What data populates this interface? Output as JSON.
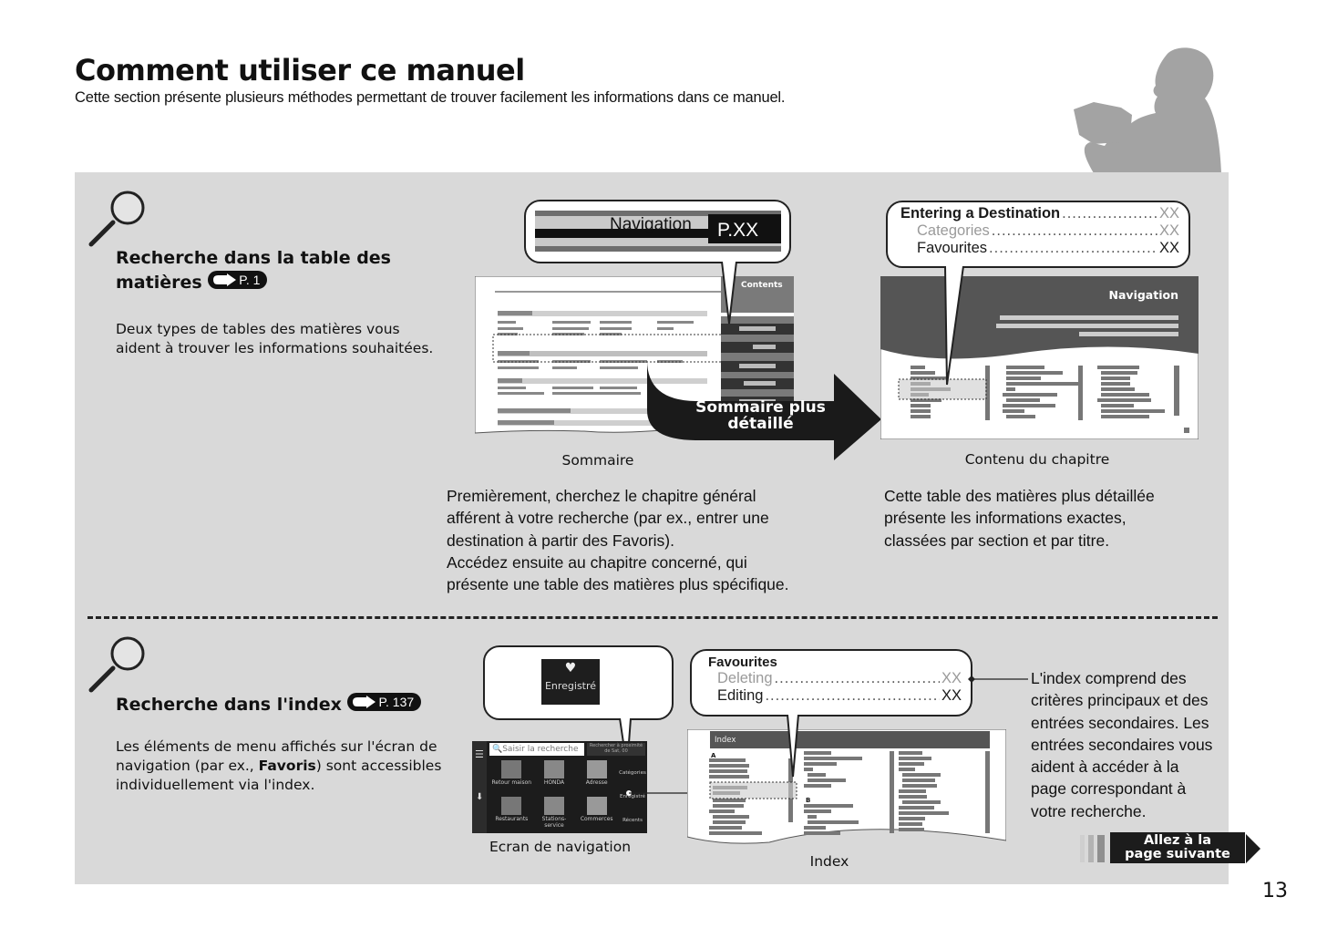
{
  "header": {
    "title": "Comment utiliser ce manuel",
    "subtitle": "Cette section présente plusieurs méthodes permettant de trouver facilement les informations dans ce manuel."
  },
  "section_toc": {
    "heading_line1": "Recherche dans la table des",
    "heading_line2": "matières",
    "page_ref": "P. 1",
    "body": [
      "Deux types de tables des matières vous",
      "aident à trouver les informations souhaitées."
    ],
    "sommaire": {
      "bubble_label": "Navigation",
      "bubble_page": "P.XX",
      "tab_label": "Contents",
      "caption": "Sommaire"
    },
    "arrow_label_line1": "Sommaire plus",
    "arrow_label_line2": "détaillé",
    "chapter": {
      "bubble_rows": [
        {
          "label": "Entering a Destination",
          "page": "XX",
          "style": "bold"
        },
        {
          "label": "Categories",
          "page": "XX",
          "style": "grey"
        },
        {
          "label": "Favourites",
          "page": "XX",
          "style": "normal"
        }
      ],
      "header_label": "Navigation",
      "caption": "Contenu du chapitre"
    },
    "para_left": [
      "Premièrement, cherchez le chapitre général",
      "afférent à votre recherche (par ex., entrer une",
      "destination à partir des Favoris).",
      "Accédez ensuite au chapitre concerné, qui",
      "présente une table des matières plus spécifique."
    ],
    "para_right": [
      "Cette table des matières plus détaillée",
      "présente les informations exactes,",
      "classées par section et par titre."
    ]
  },
  "section_index": {
    "heading": "Recherche dans l'index",
    "page_ref": "P. 137",
    "body_line1": "Les éléments de menu affichés sur l'écran de",
    "body_line2_pre": "navigation (par ex., ",
    "body_line2_bold": "Favoris",
    "body_line2_post": ") sont accessibles",
    "body_line3": "individuellement via l'index.",
    "nav_screen": {
      "bubble_button": "Enregistré",
      "search_placeholder": "Saisir la recherche",
      "top_right": "Rechercher à proximité de Sat, 00",
      "tiles": [
        "Retour maison",
        "HONDA",
        "Adresse",
        "Restaurants",
        "Stations-service",
        "Commerces"
      ],
      "side_items": [
        "Catégories",
        "Enregistré",
        "Récents"
      ],
      "caption": "Ecran de navigation"
    },
    "index_view": {
      "bubble_rows": [
        {
          "label": "Favourites",
          "page": "",
          "style": "bold"
        },
        {
          "label": "Deleting",
          "page": "XX",
          "style": "grey"
        },
        {
          "label": "Editing",
          "page": "XX",
          "style": "normal"
        }
      ],
      "header_label": "Index",
      "letters": [
        "A",
        "B"
      ],
      "caption": "Index"
    },
    "explain": [
      "L'index comprend des",
      "critères principaux et des",
      "entrées secondaires. Les",
      "entrées secondaires vous",
      "aident à accéder à la",
      "page correspondant à",
      "votre recherche."
    ]
  },
  "footer": {
    "next_line1": "Allez à la",
    "next_line2": "page suivante",
    "page_number": "13"
  }
}
